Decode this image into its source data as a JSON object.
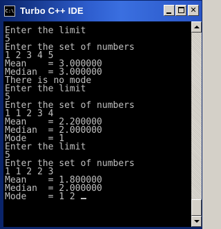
{
  "window": {
    "title": "Turbo C++ IDE",
    "icon_text": "C:\\",
    "icon": "console-icon",
    "title_color": "#0a246a"
  },
  "titlebar_buttons": {
    "minimize_icon": "minimize-icon",
    "maximize_icon": "maximize-icon",
    "close_glyph": "✕"
  },
  "console": {
    "background": "#000000",
    "foreground": "#c0c0c0",
    "lines": [
      "Enter the limit",
      "5",
      "Enter the set of numbers",
      "1 2 3 4 5",
      "Mean    = 3.000000",
      "Median  = 3.000000",
      "There is no mode",
      "Enter the limit",
      "5",
      "Enter the set of numbers",
      "1 1 2 3 4",
      "Mean    = 2.200000",
      "Median  = 2.000000",
      "Mode    = 1",
      "Enter the limit",
      "5",
      "Enter the set of numbers",
      "1 1 2 2 3",
      "Mean    = 1.800000",
      "Median  = 2.000000",
      "Mode    = 1 2 "
    ]
  },
  "scrollbar": {
    "position_fraction": 1.0
  }
}
